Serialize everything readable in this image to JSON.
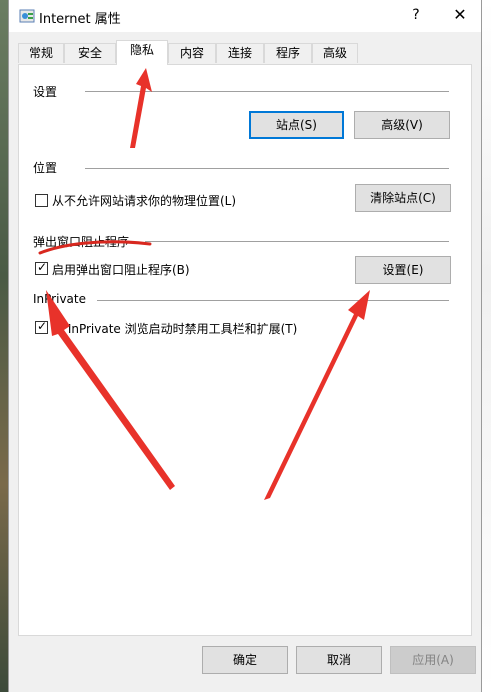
{
  "window": {
    "title": "Internet 属性",
    "help_label": "?",
    "close_label": "✕"
  },
  "tabs": [
    {
      "label": "常规"
    },
    {
      "label": "安全"
    },
    {
      "label": "隐私"
    },
    {
      "label": "内容"
    },
    {
      "label": "连接"
    },
    {
      "label": "程序"
    },
    {
      "label": "高级"
    }
  ],
  "settings": {
    "title": "设置",
    "sites_button": "站点(S)",
    "advanced_button": "高级(V)"
  },
  "location": {
    "title": "位置",
    "checkbox_label": "从不允许网站请求你的物理位置(L)",
    "checked": false,
    "clear_sites_button": "清除站点(C)"
  },
  "popup_blocker": {
    "title": "弹出窗口阻止程序",
    "checkbox_label": "启用弹出窗口阻止程序(B)",
    "checked": true,
    "settings_button": "设置(E)"
  },
  "inprivate": {
    "title": "InPrivate",
    "checkbox_label": "在 InPrivate 浏览启动时禁用工具栏和扩展(T)",
    "checked": true
  },
  "footer": {
    "ok_button": "确定",
    "cancel_button": "取消",
    "apply_button": "应用(A)"
  },
  "annotations": {
    "arrow_color": "#e8322a",
    "underline_color": "#d8281f"
  },
  "colors": {
    "default_button_border": "#0078d7",
    "button_face": "#e1e1e1",
    "window_bg": "#f0f0f0"
  }
}
